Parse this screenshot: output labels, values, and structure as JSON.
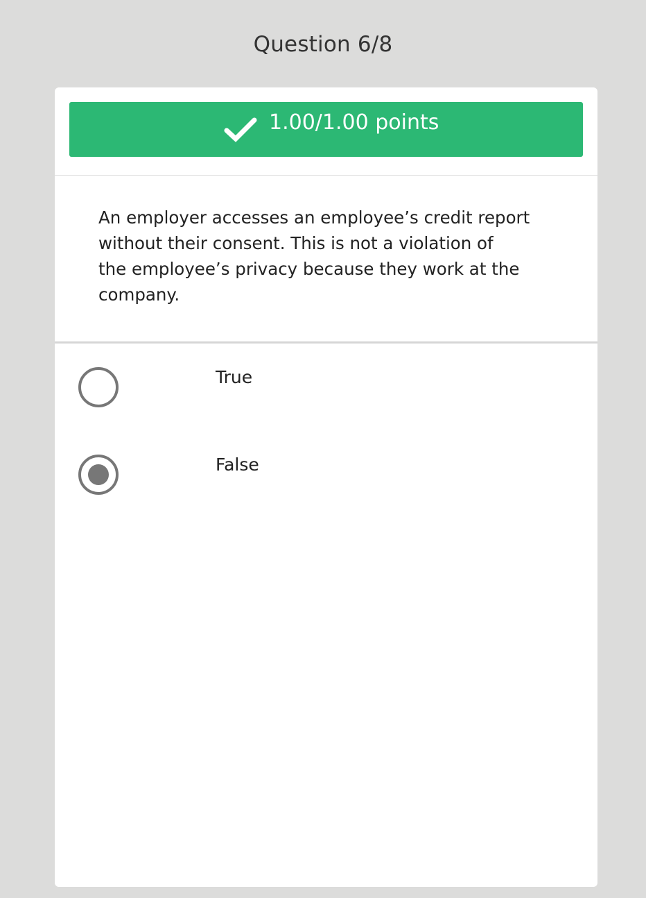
{
  "header": {
    "question_counter": "Question 6/8"
  },
  "score": {
    "icon": "checkmark-icon",
    "text": "1.00/1.00 points",
    "color": "#2cb874"
  },
  "question": {
    "lines": [
      "An employer accesses an employee’s credit report",
      "without their consent. This is not a violation of",
      "the employee’s privacy because they work at the",
      "company."
    ]
  },
  "options": [
    {
      "label": "True",
      "selected": false
    },
    {
      "label": "False",
      "selected": true
    }
  ]
}
